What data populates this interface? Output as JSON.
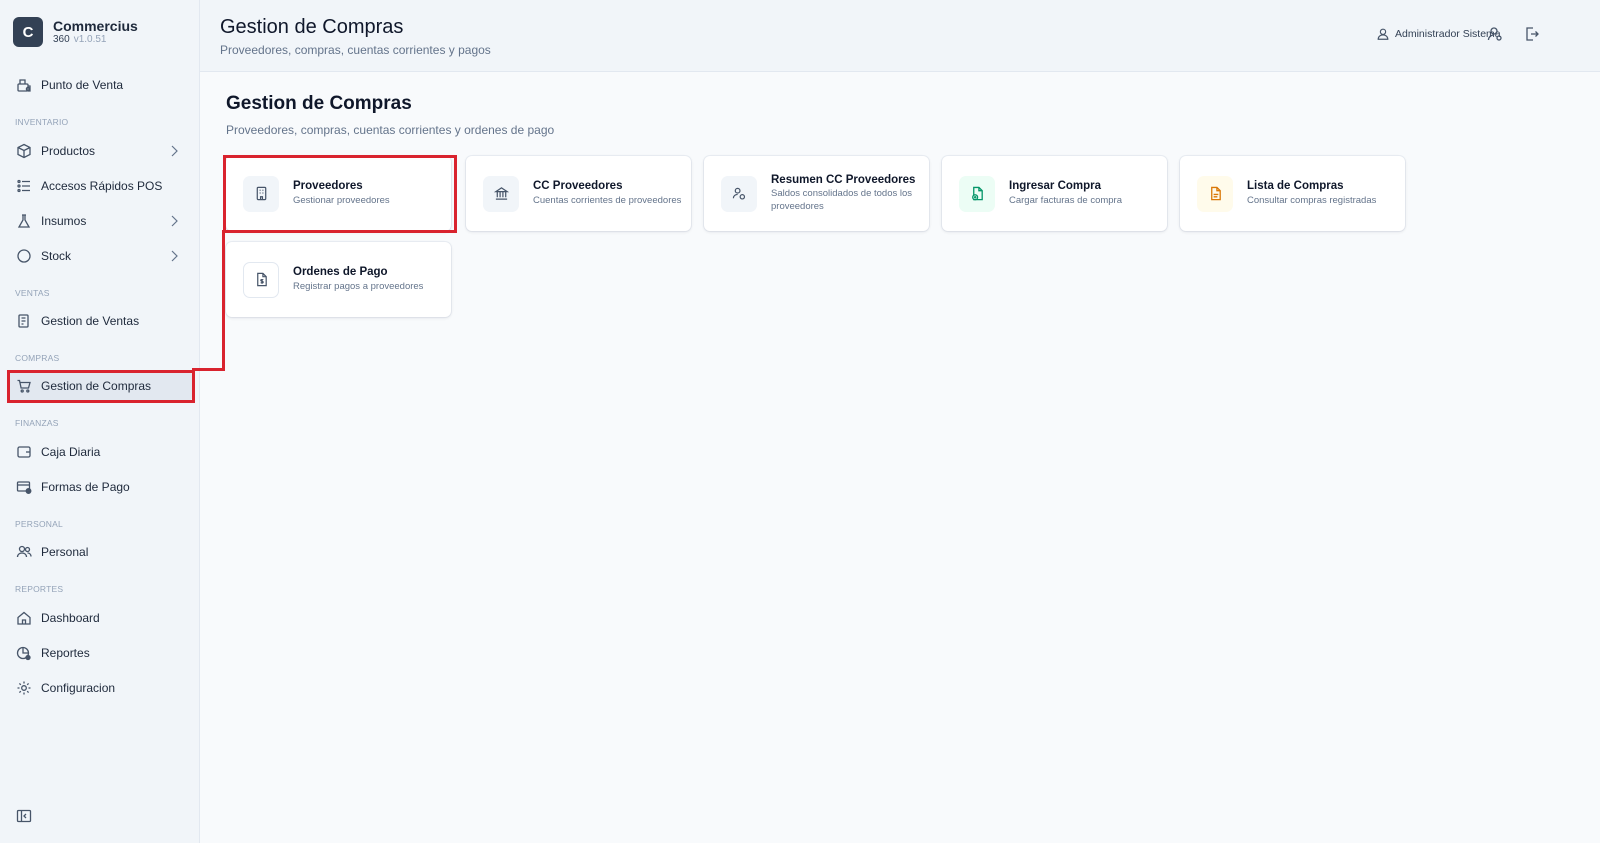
{
  "brand": {
    "logo_letter": "C",
    "name": "Commercius",
    "edition": "360",
    "version": "v1.0.51"
  },
  "sidebar": {
    "items": [
      {
        "label": "Punto de Venta",
        "icon": "cash-register-icon"
      },
      {
        "label": "Productos",
        "icon": "box-icon"
      },
      {
        "label": "Accesos Rápidos POS",
        "icon": "list-icon"
      },
      {
        "label": "Insumos",
        "icon": "flask-icon"
      },
      {
        "label": "Stock",
        "icon": "circle-icon"
      },
      {
        "label": "Gestion de Ventas",
        "icon": "receipt-icon"
      },
      {
        "label": "Gestion de Compras",
        "icon": "cart-icon"
      },
      {
        "label": "Caja Diaria",
        "icon": "wallet-icon"
      },
      {
        "label": "Formas de Pago",
        "icon": "card-settings-icon"
      },
      {
        "label": "Personal",
        "icon": "users-icon"
      },
      {
        "label": "Dashboard",
        "icon": "home-icon"
      },
      {
        "label": "Reportes",
        "icon": "report-icon"
      },
      {
        "label": "Configuracion",
        "icon": "gear-icon"
      }
    ],
    "sections": [
      "INVENTARIO",
      "VENTAS",
      "COMPRAS",
      "FINANZAS",
      "PERSONAL",
      "REPORTES"
    ],
    "active": "Gestion de Compras"
  },
  "header": {
    "title": "Gestion de Compras",
    "subtitle": "Proveedores, compras, cuentas corrientes y pagos",
    "user": "Administrador Sistema"
  },
  "main": {
    "title": "Gestion de Compras",
    "subtitle": "Proveedores, compras, cuentas corrientes y ordenes de pago",
    "cards": [
      {
        "title": "Proveedores",
        "desc": "Gestionar proveedores",
        "icon": "building-icon"
      },
      {
        "title": "CC Proveedores",
        "desc": "Cuentas corrientes de proveedores",
        "icon": "bank-icon"
      },
      {
        "title": "Resumen CC Proveedores",
        "desc": "Saldos consolidados de todos los proveedores",
        "icon": "users-settings-icon"
      },
      {
        "title": "Ingresar Compra",
        "desc": "Cargar facturas de compra",
        "icon": "file-plus-icon"
      },
      {
        "title": "Lista de Compras",
        "desc": "Consultar compras registradas",
        "icon": "file-icon"
      },
      {
        "title": "Ordenes de Pago",
        "desc": "Registrar pagos a proveedores",
        "icon": "file-dollar-icon"
      }
    ]
  },
  "colors": {
    "highlight": "#d9232e",
    "sidebar_bg": "#f1f5f9",
    "green_icon": "#059669",
    "amber_icon": "#d97706"
  }
}
